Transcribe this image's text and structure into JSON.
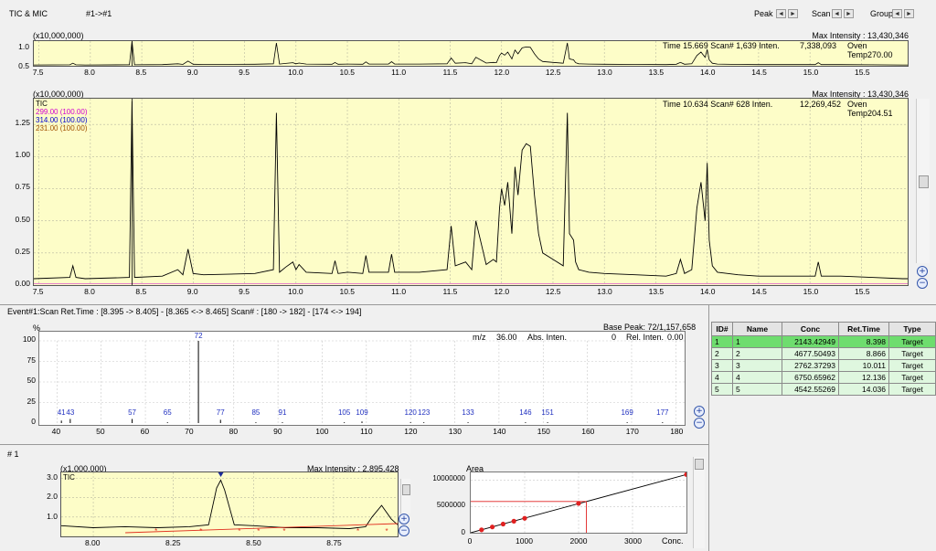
{
  "top": {
    "title": "TIC & MIC",
    "file_label": "#1->#1",
    "peak_label": "Peak",
    "scan_label": "Scan",
    "group_label": "Group",
    "prev_glyph": "◄",
    "next_glyph": "►"
  },
  "overview": {
    "scale": "(x10,000,000)",
    "max_intensity": "Max Intensity : 13,430,346",
    "info_time": "Time  15.669  Scan#  1,639  Inten.",
    "info_inten": "7,338,093",
    "info_oven": "Oven Temp270.00",
    "y_ticks": [
      "1.0",
      "0.5"
    ],
    "x_ticks": [
      "7.5",
      "8.0",
      "8.5",
      "9.0",
      "9.5",
      "10.0",
      "10.5",
      "11.0",
      "11.5",
      "12.0",
      "12.5",
      "13.0",
      "13.5",
      "14.0",
      "14.5",
      "15.0",
      "15.5"
    ]
  },
  "tic": {
    "scale": "(x10,000,000)",
    "max_intensity": "Max Intensity : 13,430,346",
    "legend": [
      {
        "label": "TIC",
        "color": "#000000"
      },
      {
        "label": "299.00 (100.00)",
        "color": "#d000d0"
      },
      {
        "label": "314.00 (100.00)",
        "color": "#0000d0"
      },
      {
        "label": "231.00 (100.00)",
        "color": "#a05000"
      }
    ],
    "info_time": "Time  10.634   Scan#   628   Inten.",
    "info_inten": "12,269,452",
    "info_oven": "Oven Temp204.51",
    "y_ticks": [
      "1.25",
      "1.00",
      "0.75",
      "0.50",
      "0.25",
      "0.00"
    ],
    "x_ticks": [
      "7.5",
      "8.0",
      "8.5",
      "9.0",
      "9.5",
      "10.0",
      "10.5",
      "11.0",
      "11.5",
      "12.0",
      "12.5",
      "13.0",
      "13.5",
      "14.0",
      "14.5",
      "15.0",
      "15.5"
    ]
  },
  "spectrum": {
    "header": "Event#1:Scan   Ret.Time : [8.395 -> 8.405] - [8.365 <-> 8.465]   Scan# : [180 -> 182] - [174 <-> 194]",
    "percent": "%",
    "base_peak": "Base Peak: 72/1,157,658",
    "mz_label": "m/z",
    "mz_value": "36.00",
    "abs_label": "Abs. Inten.",
    "abs_value": "0",
    "rel_label": "Rel. Inten.",
    "rel_value": "0.00",
    "y_ticks": [
      "100",
      "75",
      "50",
      "25",
      "0"
    ],
    "x_ticks": [
      "40",
      "50",
      "60",
      "70",
      "80",
      "90",
      "100",
      "110",
      "120",
      "130",
      "140",
      "150",
      "160",
      "170",
      "180"
    ]
  },
  "peak_panel": {
    "id_label": "#   1",
    "scale": "(x1,000,000)",
    "max_intensity": "Max Intensity : 2,895,428",
    "tic_label": "TIC",
    "y_ticks": [
      "3.0",
      "2.0",
      "1.0"
    ],
    "x_ticks": [
      "8.00",
      "8.25",
      "8.50",
      "8.75"
    ]
  },
  "calibration": {
    "area_label": "Area",
    "conc_label": "Conc.",
    "y_ticks": [
      "10000000",
      "5000000",
      "0"
    ],
    "x_ticks": [
      "0",
      "1000",
      "2000",
      "3000"
    ]
  },
  "compound_table": {
    "headers": [
      "ID#",
      "Name",
      "Conc",
      "Ret.Time",
      "Type"
    ],
    "rows": [
      {
        "id": "1",
        "name": "1",
        "conc": "2143.42949",
        "rt": "8.398",
        "type": "Target"
      },
      {
        "id": "2",
        "name": "2",
        "conc": "4677.50493",
        "rt": "8.866",
        "type": "Target"
      },
      {
        "id": "3",
        "name": "3",
        "conc": "2762.37293",
        "rt": "10.011",
        "type": "Target"
      },
      {
        "id": "4",
        "name": "4",
        "conc": "6750.65962",
        "rt": "12.136",
        "type": "Target"
      },
      {
        "id": "5",
        "name": "5",
        "conc": "4542.55269",
        "rt": "14.036",
        "type": "Target"
      }
    ]
  },
  "chart_data": [
    {
      "type": "line",
      "xlabel": "",
      "ylabel": "",
      "xlim": [
        7.45,
        15.95
      ],
      "ylim": [
        0,
        1.45
      ],
      "series": [
        {
          "name": "TIC",
          "x": [
            7.45,
            7.8,
            7.83,
            7.86,
            7.95,
            8.38,
            8.405,
            8.43,
            8.7,
            8.85,
            8.9,
            8.95,
            9.0,
            9.1,
            9.6,
            9.78,
            9.81,
            9.84,
            9.9,
            9.97,
            10.0,
            10.03,
            10.1,
            10.35,
            10.38,
            10.41,
            10.5,
            10.65,
            10.68,
            10.71,
            10.9,
            10.93,
            10.96,
            11.2,
            11.47,
            11.51,
            11.55,
            11.65,
            11.71,
            11.75,
            11.85,
            11.92,
            11.95,
            11.98,
            12.0,
            12.03,
            12.06,
            12.1,
            12.13,
            12.16,
            12.2,
            12.24,
            12.28,
            12.32,
            12.36,
            12.4,
            12.5,
            12.6,
            12.64,
            12.66,
            12.7,
            12.72,
            12.75,
            12.85,
            13.0,
            13.3,
            13.6,
            13.7,
            13.74,
            13.78,
            13.85,
            13.9,
            13.94,
            13.98,
            14.0,
            14.02,
            14.05,
            14.1,
            14.3,
            14.5,
            14.7,
            14.9,
            15.05,
            15.08,
            15.11,
            15.3,
            15.6,
            15.9,
            15.95
          ],
          "y": [
            0.05,
            0.06,
            0.15,
            0.06,
            0.05,
            0.06,
            1.43,
            0.06,
            0.07,
            0.12,
            0.08,
            0.28,
            0.09,
            0.08,
            0.09,
            0.12,
            1.34,
            0.1,
            0.14,
            0.18,
            0.12,
            0.16,
            0.1,
            0.09,
            0.19,
            0.09,
            0.1,
            0.09,
            0.23,
            0.1,
            0.1,
            0.24,
            0.1,
            0.1,
            0.12,
            0.46,
            0.15,
            0.18,
            0.12,
            0.5,
            0.16,
            0.2,
            0.18,
            0.6,
            0.75,
            0.62,
            0.8,
            0.4,
            0.92,
            0.7,
            1.05,
            1.1,
            1.08,
            0.7,
            0.4,
            0.25,
            0.2,
            0.15,
            1.34,
            0.4,
            0.35,
            0.18,
            0.12,
            0.1,
            0.09,
            0.08,
            0.07,
            0.09,
            0.2,
            0.09,
            0.12,
            0.6,
            0.8,
            0.5,
            0.95,
            0.35,
            0.15,
            0.1,
            0.08,
            0.07,
            0.07,
            0.07,
            0.07,
            0.18,
            0.07,
            0.07,
            0.06,
            0.05,
            0.05
          ]
        }
      ]
    },
    {
      "type": "bar",
      "xlabel": "m/z",
      "ylabel": "%",
      "xlim": [
        36,
        182
      ],
      "ylim": [
        0,
        100
      ],
      "x": [
        41,
        43,
        57,
        65,
        72,
        77,
        85,
        91,
        105,
        109,
        120,
        123,
        133,
        146,
        151,
        169,
        177
      ],
      "values": [
        3,
        5,
        5,
        1,
        100,
        4,
        1,
        1,
        1,
        2,
        1,
        1,
        1,
        1,
        1,
        1,
        1
      ]
    },
    {
      "type": "line",
      "xlabel": "",
      "ylabel": "",
      "xlim": [
        7.9,
        8.95
      ],
      "ylim": [
        0,
        3.3
      ],
      "series": [
        {
          "name": "TIC",
          "x": [
            7.9,
            8.0,
            8.1,
            8.2,
            8.3,
            8.36,
            8.385,
            8.398,
            8.41,
            8.44,
            8.5,
            8.55,
            8.6,
            8.7,
            8.8,
            8.85,
            8.87,
            8.9,
            8.93,
            8.95
          ],
          "y": [
            0.55,
            0.45,
            0.5,
            0.45,
            0.5,
            0.6,
            2.5,
            2.9,
            2.4,
            0.6,
            0.55,
            0.5,
            0.45,
            0.45,
            0.4,
            0.5,
            1.0,
            1.6,
            0.9,
            0.6
          ]
        }
      ]
    },
    {
      "type": "scatter",
      "xlabel": "Conc.",
      "ylabel": "Area",
      "xlim": [
        0,
        4000
      ],
      "ylim": [
        0,
        11500000
      ],
      "x": [
        200,
        400,
        600,
        800,
        1000,
        2000,
        4000
      ],
      "values": [
        550000,
        1100000,
        1650000,
        2200000,
        2750000,
        5600000,
        11100000
      ],
      "fit_line": {
        "x": [
          0,
          4000
        ],
        "y": [
          0,
          11100000
        ]
      },
      "marker": {
        "x": 2143,
        "y": 5950000
      }
    }
  ]
}
